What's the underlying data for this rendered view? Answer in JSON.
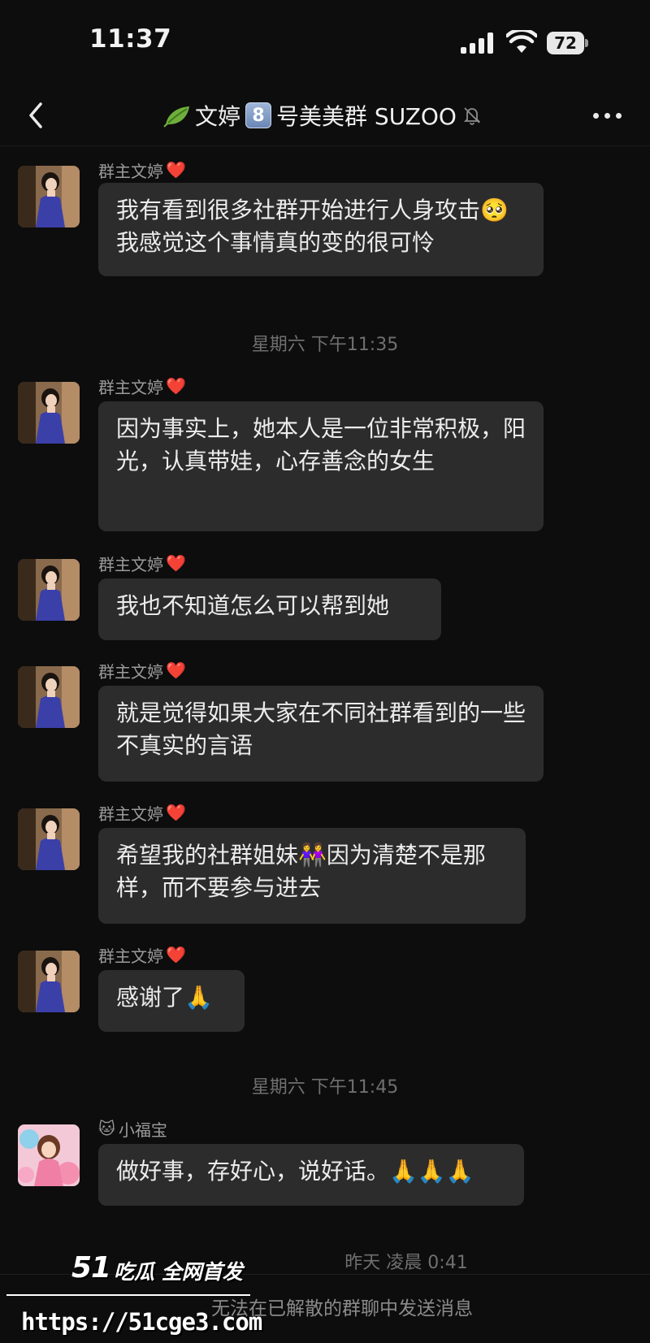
{
  "status_bar": {
    "time": "11:37",
    "battery": "72"
  },
  "header": {
    "title_part1": "文婷",
    "badge": "8",
    "title_part2": "号美美群 SUZOO",
    "leaf_icon": "leaf-icon",
    "mute_icon": "bell-slash-icon"
  },
  "messages": [
    {
      "sender": "群主文婷",
      "sender_suffix": "❤️",
      "text": "我有看到很多社群开始进行人身攻击🥺我感觉这个事情真的变的很可怜"
    },
    {
      "sender": "群主文婷",
      "sender_suffix": "❤️",
      "text": "因为事实上，她本人是一位非常积极，阳光，认真带娃，心存善念的女生"
    },
    {
      "sender": "群主文婷",
      "sender_suffix": "❤️",
      "text": "我也不知道怎么可以帮到她"
    },
    {
      "sender": "群主文婷",
      "sender_suffix": "❤️",
      "text": "就是觉得如果大家在不同社群看到的一些不真实的言语"
    },
    {
      "sender": "群主文婷",
      "sender_suffix": "❤️",
      "text": "希望我的社群姐妹👭因为清楚不是那样，而不要参与进去"
    },
    {
      "sender": "群主文婷",
      "sender_suffix": "❤️",
      "text": "感谢了🙏"
    },
    {
      "sender": "小福宝",
      "sender_prefix": "🐱",
      "text": "做好事，存好心，说好话。🙏🙏🙏"
    }
  ],
  "time_separators": [
    "星期六 下午11:35",
    "星期六 下午11:45",
    "昨天 凌晨 0:41"
  ],
  "bottom_bar": {
    "text": "无法在已解散的群聊中发送消息"
  },
  "watermark": {
    "logo": "51",
    "logo_sub": "吃瓜 全网首发",
    "url": "https://51cge3.com"
  },
  "colors": {
    "background": "#0d0d0d",
    "bubble": "#2c2c2c",
    "heart": "#e8262d"
  }
}
